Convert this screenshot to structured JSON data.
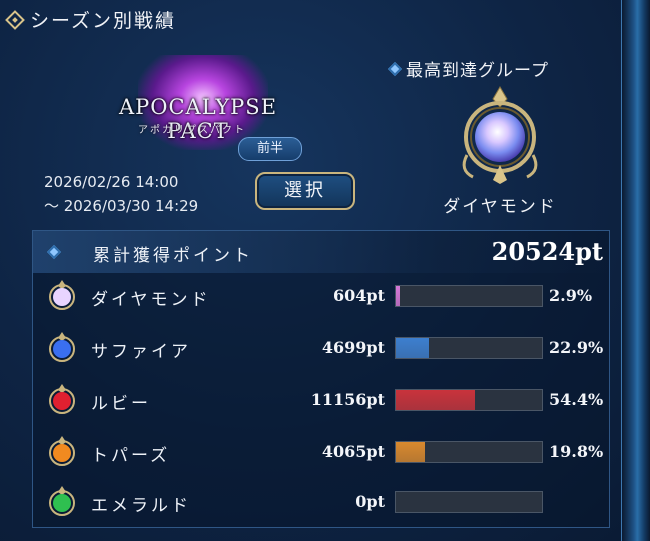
{
  "header": {
    "title": "シーズン別戦績",
    "icon": "diamond-emblem-icon"
  },
  "event": {
    "logo_title": "APOCALYPSE PACT",
    "logo_subtitle": "アポカリプスパクト",
    "phase": "前半",
    "start": "2026/02/26 14:00",
    "end": "～ 2026/03/30 14:29",
    "select_label": "選択"
  },
  "rank": {
    "header": "最高到達グループ",
    "name": "ダイヤモンド",
    "icon": "diamond-rank-emblem-icon"
  },
  "points": {
    "label": "累計獲得ポイント",
    "total": "20524pt",
    "rows": [
      {
        "name": "ダイヤモンド",
        "pts": "604pt",
        "pct": "2.9%",
        "ratio": 0.029,
        "color": "#d678d8",
        "gem": "#e8d4ff",
        "icon": "diamond-gem-icon"
      },
      {
        "name": "サファイア",
        "pts": "4699pt",
        "pct": "22.9%",
        "ratio": 0.229,
        "color": "#3d7fcf",
        "gem": "#3a6ff0",
        "icon": "sapphire-gem-icon"
      },
      {
        "name": "ルビー",
        "pts": "11156pt",
        "pct": "54.4%",
        "ratio": 0.544,
        "color": "#c9333c",
        "gem": "#e02030",
        "icon": "ruby-gem-icon"
      },
      {
        "name": "トパーズ",
        "pts": "4065pt",
        "pct": "19.8%",
        "ratio": 0.198,
        "color": "#d9892e",
        "gem": "#f08a20",
        "icon": "topaz-gem-icon"
      },
      {
        "name": "エメラルド",
        "pts": "0pt",
        "pct": "",
        "ratio": 0,
        "color": "#2fae5a",
        "gem": "#2fbf50",
        "icon": "emerald-gem-icon"
      }
    ]
  }
}
